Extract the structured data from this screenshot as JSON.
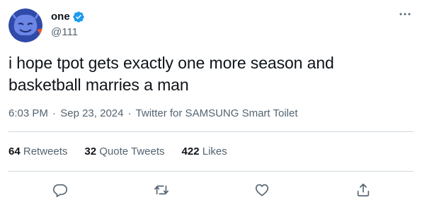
{
  "author": {
    "display_name": "one",
    "handle": "@111",
    "verified_color": "#1d9bf0",
    "avatar_color": "#2f4aa8",
    "avatar_bg": "#e8542f"
  },
  "tweet": {
    "text": "i hope tpot gets exactly one more season and basketball marries a man"
  },
  "meta": {
    "time": "6:03 PM",
    "separator": "·",
    "date": "Sep 23, 2024",
    "source": "Twitter for SAMSUNG Smart Toilet"
  },
  "stats": {
    "retweets": {
      "count": "64",
      "label": "Retweets"
    },
    "quotes": {
      "count": "32",
      "label": "Quote Tweets"
    },
    "likes": {
      "count": "422",
      "label": "Likes"
    }
  },
  "actions": {
    "reply_icon": "reply-icon",
    "retweet_icon": "retweet-icon",
    "like_icon": "heart-icon",
    "share_icon": "share-icon"
  },
  "colors": {
    "text_primary": "#0f1419",
    "text_secondary": "#536471",
    "divider": "#cfd9de",
    "action_icon": "#536471"
  }
}
